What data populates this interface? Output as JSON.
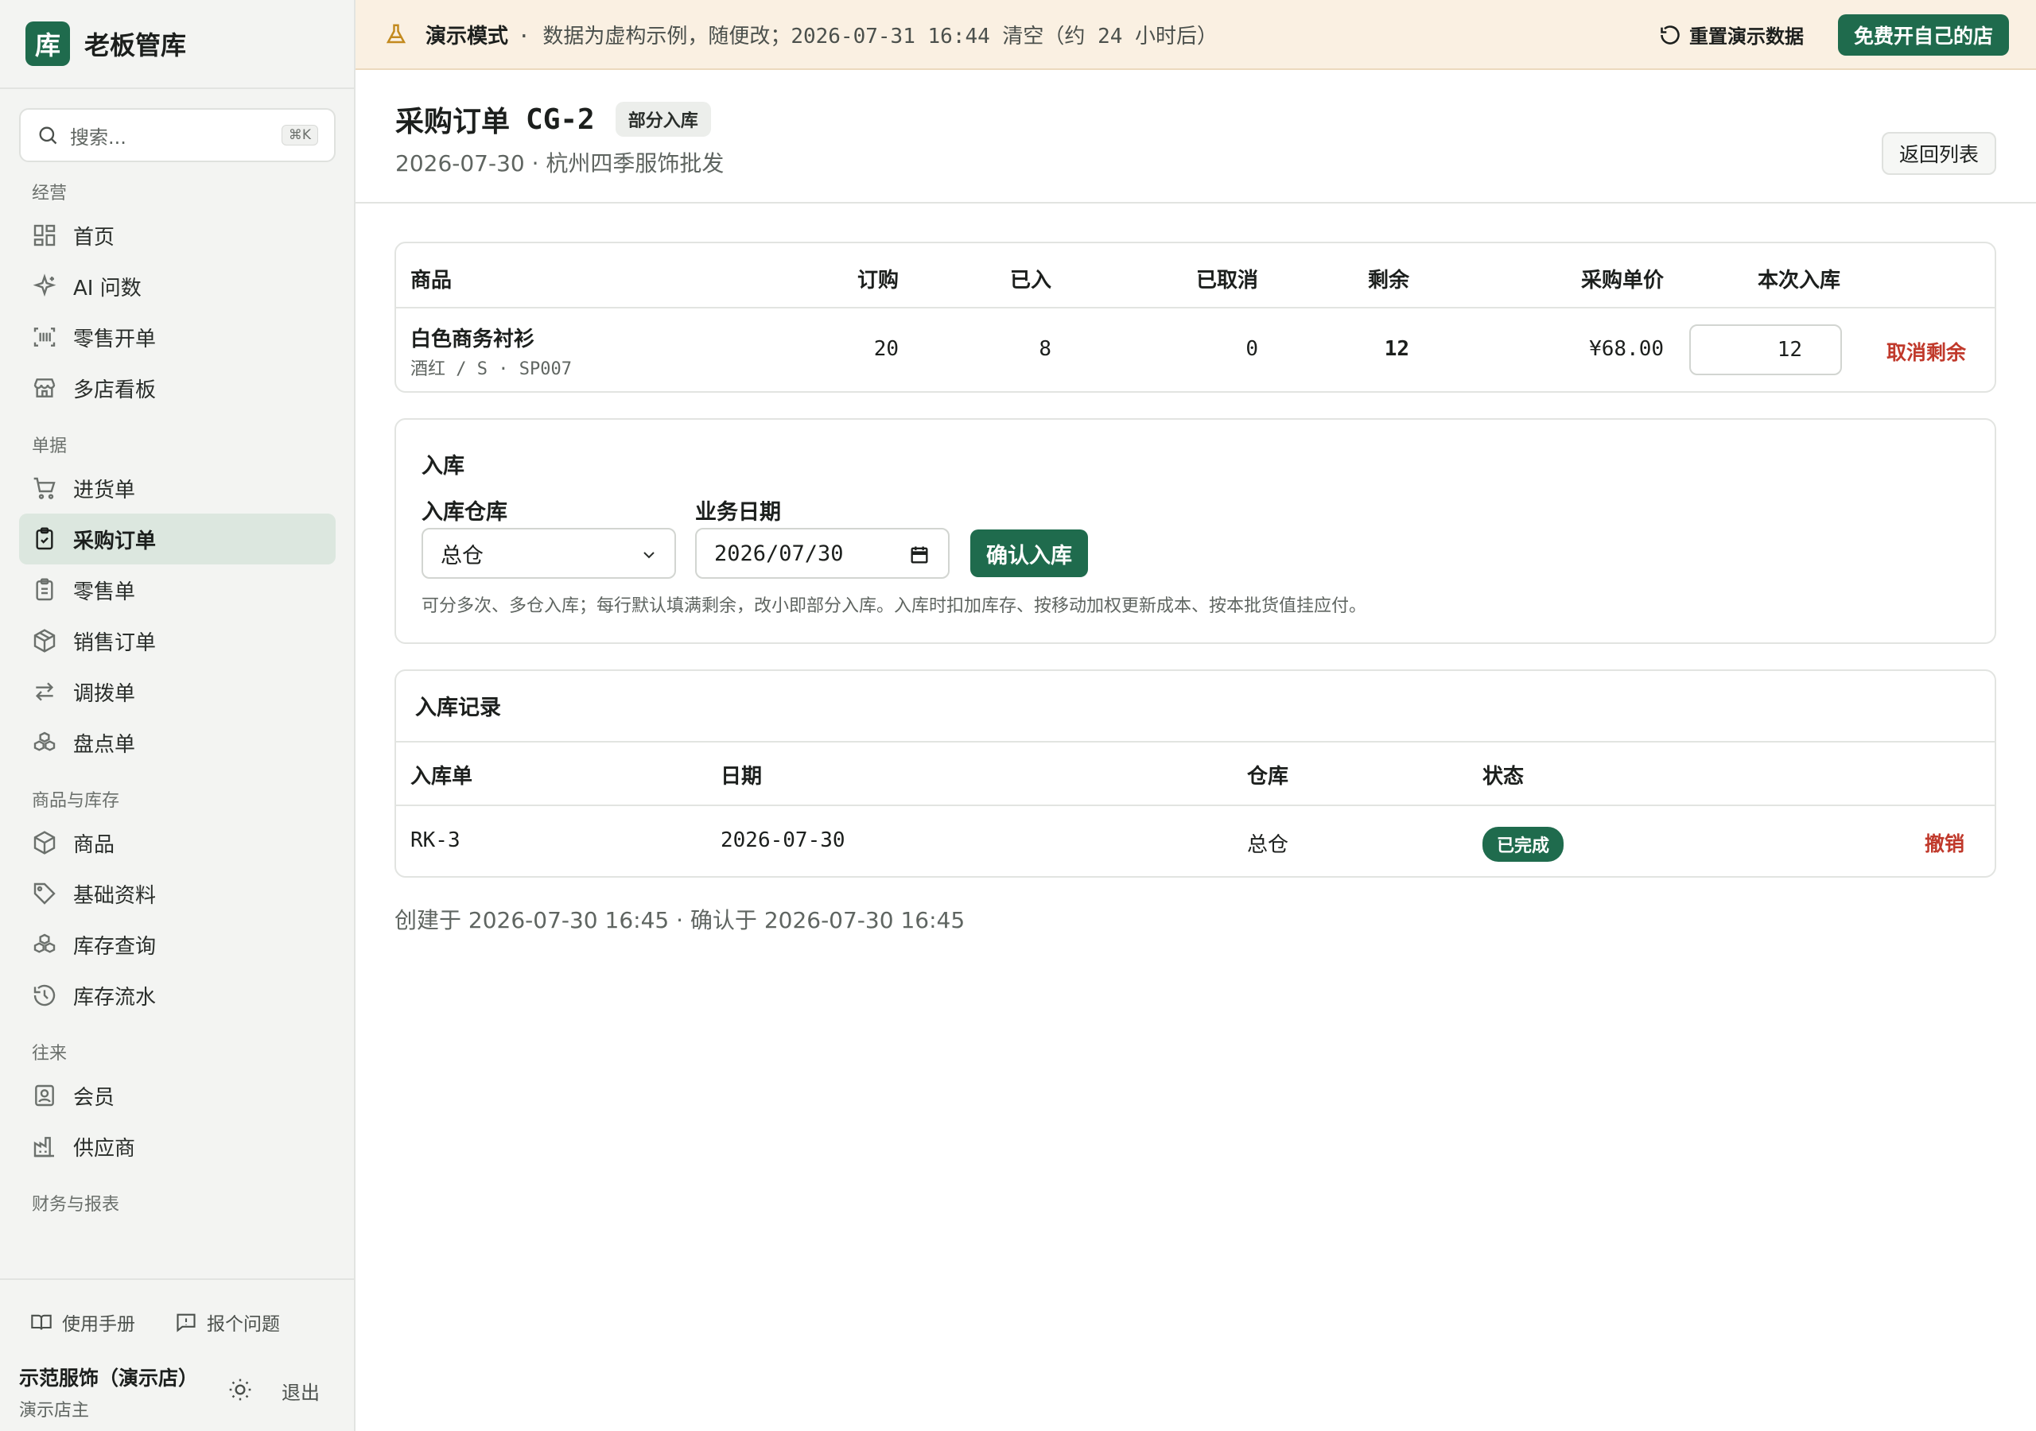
{
  "sidebar": {
    "brand_logo": "库",
    "brand_name": "老板管库",
    "search_placeholder": "搜索...",
    "search_shortcut": "⌘K",
    "groups": [
      {
        "title": "经营",
        "items": [
          {
            "label": "首页",
            "icon": "dashboard-icon"
          },
          {
            "label": "AI 问数",
            "icon": "sparkle-icon"
          },
          {
            "label": "零售开单",
            "icon": "barcode-scan-icon"
          },
          {
            "label": "多店看板",
            "icon": "store-icon"
          }
        ]
      },
      {
        "title": "单据",
        "items": [
          {
            "label": "进货单",
            "icon": "cart-icon"
          },
          {
            "label": "采购订单",
            "icon": "clipboard-check-icon",
            "active": true
          },
          {
            "label": "零售单",
            "icon": "receipt-icon"
          },
          {
            "label": "销售订单",
            "icon": "package-icon"
          },
          {
            "label": "调拨单",
            "icon": "transfer-icon"
          },
          {
            "label": "盘点单",
            "icon": "boxes-icon"
          }
        ]
      },
      {
        "title": "商品与库存",
        "items": [
          {
            "label": "商品",
            "icon": "box-icon"
          },
          {
            "label": "基础资料",
            "icon": "tag-icon"
          },
          {
            "label": "库存查询",
            "icon": "stack-icon"
          },
          {
            "label": "库存流水",
            "icon": "history-icon"
          }
        ]
      },
      {
        "title": "往来",
        "items": [
          {
            "label": "会员",
            "icon": "member-card-icon"
          },
          {
            "label": "供应商",
            "icon": "factory-icon"
          }
        ]
      },
      {
        "title": "财务与报表",
        "items": []
      }
    ],
    "footer": {
      "manual_label": "使用手册",
      "report_label": "报个问题",
      "user_name": "示范服饰（演示店）",
      "user_role": "演示店主",
      "logout_label": "退出"
    }
  },
  "banner": {
    "title": "演示模式",
    "text": "· 数据为虚构示例，随便改；2026-07-31 16:44 清空（约 24 小时后）",
    "reset_label": "重置演示数据",
    "open_label": "免费开自己的店",
    "accent": "#c38a1e"
  },
  "header": {
    "title": "采购订单",
    "code": "CG-2",
    "status_badge": "部分入库",
    "subtitle": "2026-07-30 · 杭州四季服饰批发",
    "back_label": "返回列表"
  },
  "order_table": {
    "headers": [
      "商品",
      "订购",
      "已入",
      "已取消",
      "剩余",
      "采购单价",
      "本次入库"
    ],
    "rows": [
      {
        "name": "白色商务衬衫",
        "variant": "酒红 / S · SP007",
        "ordered": "20",
        "received": "8",
        "cancelled": "0",
        "remaining": "12",
        "unit_price": "¥68.00",
        "this_qty": "12",
        "action": "取消剩余"
      }
    ]
  },
  "stock_in": {
    "title": "入库",
    "warehouse_label": "入库仓库",
    "warehouse_value": "总仓",
    "date_label": "业务日期",
    "date_value": "2026/07/30",
    "confirm_label": "确认入库",
    "hint": "可分多次、多仓入库；每行默认填满剩余，改小即部分入库。入库时扣加库存、按移动加权更新成本、按本批货值挂应付。"
  },
  "records": {
    "title": "入库记录",
    "headers": [
      "入库单",
      "日期",
      "仓库",
      "状态"
    ],
    "rows": [
      {
        "code": "RK-3",
        "date": "2026-07-30",
        "warehouse": "总仓",
        "status": "已完成",
        "action": "撤销"
      }
    ]
  },
  "meta_line": "创建于 2026-07-30 16:45 · 确认于 2026-07-30 16:45",
  "colors": {
    "primary": "#1f6b4d",
    "danger": "#c0392b",
    "active_nav": "#dce7df"
  }
}
